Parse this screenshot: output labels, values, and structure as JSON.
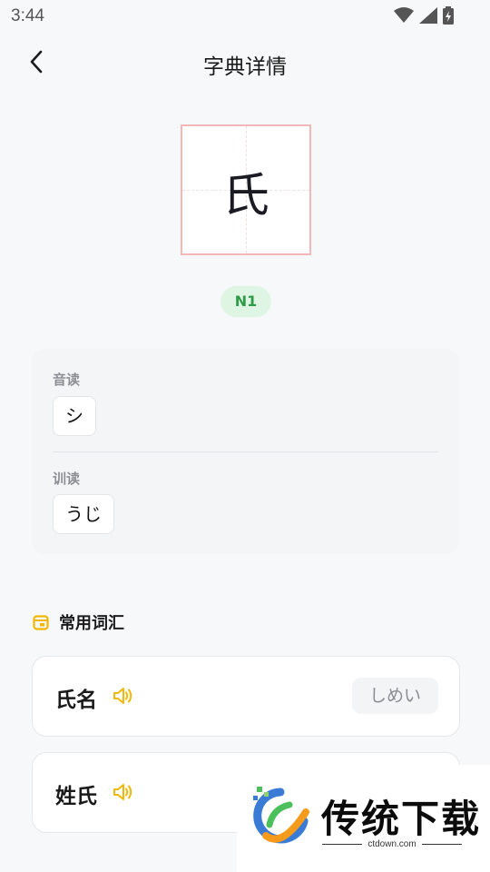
{
  "status_bar": {
    "time": "3:44",
    "icons": [
      "wifi-icon",
      "signal-icon",
      "battery-charging-icon"
    ]
  },
  "header": {
    "title": "字典详情",
    "back_icon": "chevron-left-icon"
  },
  "kanji": {
    "character": "氏",
    "level": "N1"
  },
  "readings": {
    "onyomi_label": "音读",
    "onyomi": [
      "シ"
    ],
    "kunyomi_label": "训读",
    "kunyomi": [
      "うじ"
    ]
  },
  "vocab_section": {
    "title": "常用词汇",
    "icon": "calendar-icon",
    "accent": "#f2b705",
    "items": [
      {
        "word": "氏名",
        "reading": "しめい"
      },
      {
        "word": "姓氏",
        "reading": ""
      }
    ]
  },
  "watermark": {
    "text": "传统下载",
    "url": "ctdown.com"
  }
}
